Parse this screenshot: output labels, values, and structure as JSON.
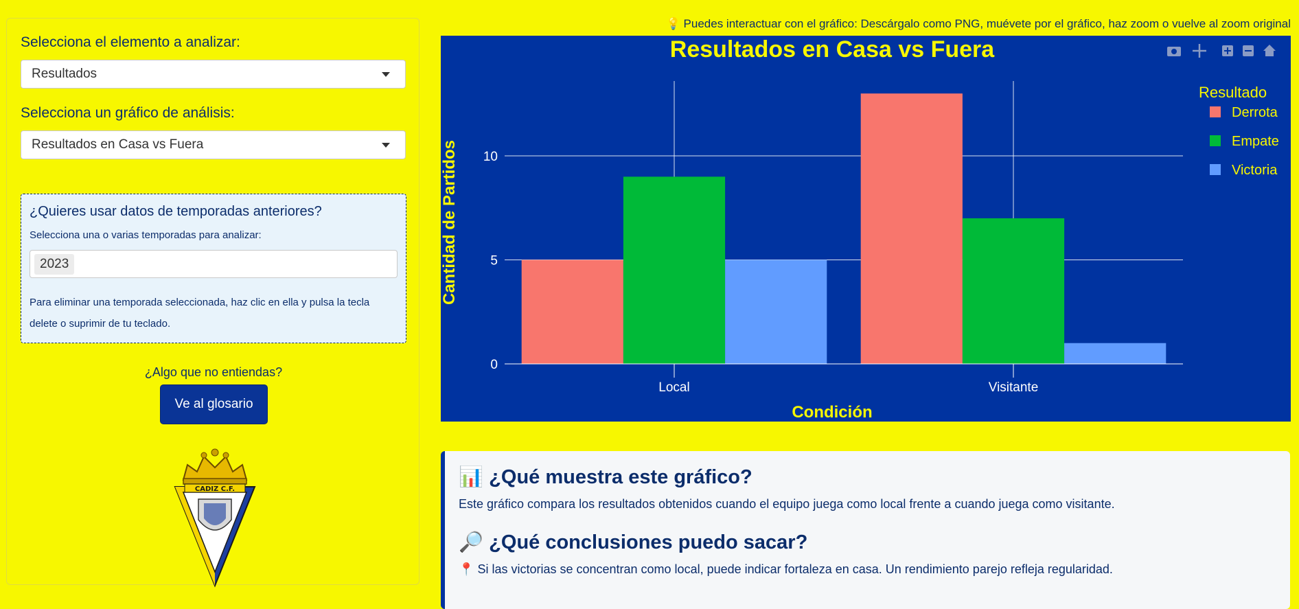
{
  "sidebar": {
    "element_label": "Selecciona el elemento a analizar:",
    "element_value": "Resultados",
    "chart_label": "Selecciona un gráfico de análisis:",
    "chart_value": "Resultados en Casa vs Fuera",
    "seasons_title": "¿Quieres usar datos de temporadas anteriores?",
    "seasons_subtitle": "Selecciona una o varias temporadas para analizar:",
    "selected_season": "2023",
    "seasons_help": "Para eliminar una temporada seleccionada, haz clic en ella y pulsa la tecla delete o suprimir de tu teclado.",
    "question": "¿Algo que no entiendas?",
    "glossary_button": "Ve al glosario",
    "crest_text": "CADIZ C.F."
  },
  "hint": {
    "icon": "💡",
    "text": "Puedes interactuar con el gráfico: Descárgalo como PNG, muévete por el gráfico, haz zoom o vuelve al zoom original"
  },
  "modebar": [
    "camera-icon",
    "pan-icon",
    "zoom-in-icon",
    "zoom-out-icon",
    "home-icon"
  ],
  "colors": {
    "background": "#f7f700",
    "chart_bg": "#0033a0",
    "title": "#f7f700",
    "derrota": "#f8766d",
    "empate": "#00ba38",
    "victoria": "#619cff"
  },
  "chart_data": {
    "type": "bar",
    "title": "Resultados en Casa vs Fuera",
    "xlabel": "Condición",
    "ylabel": "Cantidad de Partidos",
    "categories": [
      "Local",
      "Visitante"
    ],
    "legend_title": "Resultado",
    "legend_position": "right",
    "grid": true,
    "ylim": [
      0,
      13.6
    ],
    "yticks": [
      0,
      5,
      10
    ],
    "series": [
      {
        "name": "Derrota",
        "color": "#f8766d",
        "values": [
          5,
          13
        ]
      },
      {
        "name": "Empate",
        "color": "#00ba38",
        "values": [
          9,
          7
        ]
      },
      {
        "name": "Victoria",
        "color": "#619cff",
        "values": [
          5,
          1
        ]
      }
    ]
  },
  "info": {
    "h1_icon": "📊",
    "h1": "¿Qué muestra este gráfico?",
    "p1": "Este gráfico compara los resultados obtenidos cuando el equipo juega como local frente a cuando juega como visitante.",
    "h2_icon": "🔎",
    "h2": "¿Qué conclusiones puedo sacar?",
    "p2_icon": "📍",
    "p2": "Si las victorias se concentran como local, puede indicar fortaleza en casa. Un rendimiento parejo refleja regularidad."
  }
}
